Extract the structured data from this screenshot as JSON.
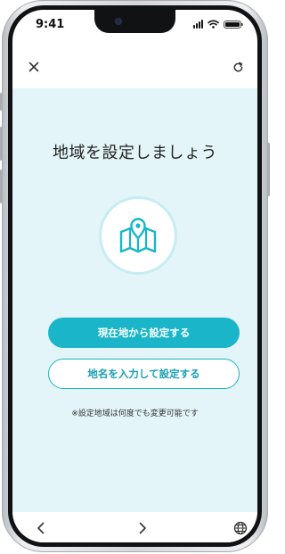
{
  "status_bar": {
    "time": "9:41"
  },
  "header": {
    "close_icon": "close-icon",
    "refresh_icon": "refresh-icon"
  },
  "main": {
    "title": "地域を設定しましょう",
    "illustration_icon": "map-pin-icon",
    "current_location_button": "現在地から設定する",
    "manual_input_button": "地名を入力して設定する",
    "note": "※設定地域は何度でも変更可能です"
  },
  "bottom_nav": {
    "back_icon": "chevron-left-icon",
    "forward_icon": "chevron-right-icon",
    "globe_icon": "globe-icon"
  },
  "colors": {
    "accent": "#1ab5c9",
    "background": "#e3f5f8"
  }
}
